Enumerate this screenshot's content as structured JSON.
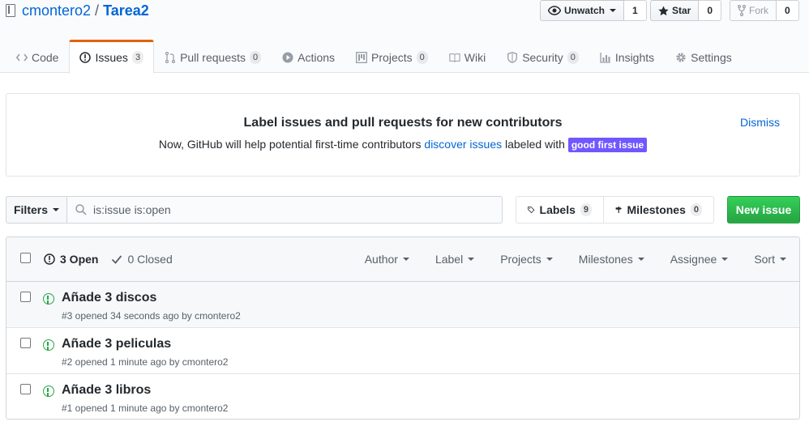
{
  "repo": {
    "owner": "cmontero2",
    "separator": "/",
    "name": "Tarea2"
  },
  "actions": {
    "watch": {
      "label": "Unwatch",
      "count": "1"
    },
    "star": {
      "label": "Star",
      "count": "0"
    },
    "fork": {
      "label": "Fork",
      "count": "0"
    }
  },
  "nav": {
    "code": "Code",
    "issues": "Issues",
    "issues_count": "3",
    "pulls": "Pull requests",
    "pulls_count": "0",
    "actions": "Actions",
    "projects": "Projects",
    "projects_count": "0",
    "wiki": "Wiki",
    "security": "Security",
    "security_count": "0",
    "insights": "Insights",
    "settings": "Settings"
  },
  "banner": {
    "title": "Label issues and pull requests for new contributors",
    "text_before": "Now, GitHub will help potential first-time contributors ",
    "link": "discover issues",
    "text_after": " labeled with ",
    "label": "good first issue",
    "dismiss": "Dismiss"
  },
  "toolbar": {
    "filters": "Filters",
    "search_value": "is:issue is:open",
    "labels": "Labels",
    "labels_count": "9",
    "milestones": "Milestones",
    "milestones_count": "0",
    "new_issue": "New issue"
  },
  "list_header": {
    "open": "3 Open",
    "closed": "0 Closed",
    "filters": [
      "Author",
      "Label",
      "Projects",
      "Milestones",
      "Assignee",
      "Sort"
    ]
  },
  "issues": [
    {
      "title": "Añade 3 discos",
      "meta": "#3 opened 34 seconds ago by cmontero2"
    },
    {
      "title": "Añade 3 peliculas",
      "meta": "#2 opened 1 minute ago by cmontero2"
    },
    {
      "title": "Añade 3 libros",
      "meta": "#1 opened 1 minute ago by cmontero2"
    }
  ],
  "colors": {
    "link": "#0366d6",
    "open_green": "#28a745",
    "accent_orange": "#e36209",
    "label_purple": "#7057ff"
  }
}
